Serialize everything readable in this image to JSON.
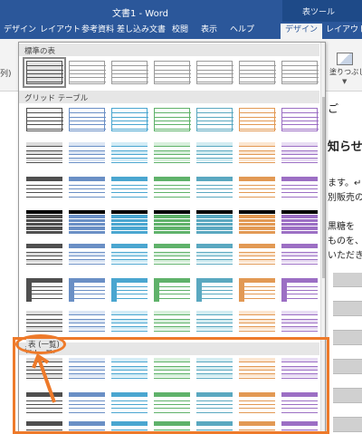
{
  "window": {
    "title": "文書1 - Word",
    "context_group": "表ツール"
  },
  "tabs": [
    {
      "label": "デザイン",
      "state": "normal"
    },
    {
      "label": "レイアウト",
      "state": "normal"
    },
    {
      "label": "参考資料",
      "state": "normal"
    },
    {
      "label": "差し込み文書",
      "state": "normal"
    },
    {
      "label": "校閲",
      "state": "normal"
    },
    {
      "label": "表示",
      "state": "normal"
    },
    {
      "label": "ヘルプ",
      "state": "normal"
    },
    {
      "label": "デザイン",
      "state": "active"
    },
    {
      "label": "レイアウト",
      "state": "context"
    }
  ],
  "ribbon": {
    "left_label": "列)",
    "shading_label": "塗りつぶし",
    "shading_arrow": "▼"
  },
  "gallery": {
    "sections": [
      {
        "title": "標準の表"
      },
      {
        "title": "グリッド テーブル"
      },
      {
        "title": "表 (一覧)"
      }
    ],
    "palette": [
      "#4f4f4f",
      "#6a8fc5",
      "#4aa6d0",
      "#5fb26a",
      "#5aa8c0",
      "#e29954",
      "#9c6fc4"
    ],
    "palette_light": [
      "#dcdcdc",
      "#dce6f4",
      "#d3ecf6",
      "#d8efdc",
      "#d3ecf1",
      "#fbe6d1",
      "#e8ddf3"
    ]
  },
  "document": {
    "lines": [
      "ご",
      "知らせ",
      "ます。↵",
      "別販売の",
      "黒糖を",
      "ものを、",
      "いただき"
    ]
  },
  "annotation": {
    "color": "#ee7a2a"
  }
}
